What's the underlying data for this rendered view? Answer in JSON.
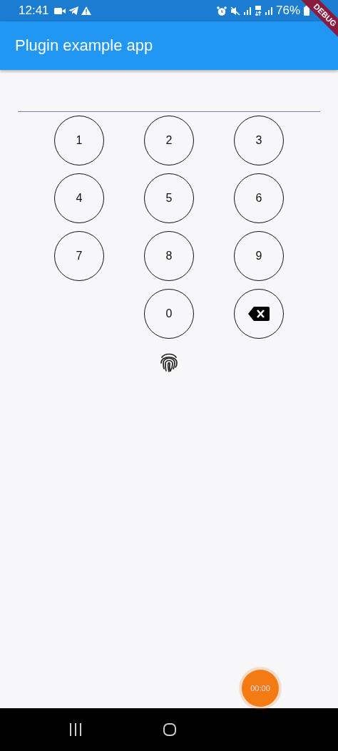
{
  "status_bar": {
    "time": "12:41",
    "battery": "76%"
  },
  "app_bar": {
    "title": "Plugin example app"
  },
  "debug_banner": {
    "label": "DEBUG"
  },
  "keypad": [
    {
      "kind": "digit",
      "label": "1"
    },
    {
      "kind": "digit",
      "label": "2"
    },
    {
      "kind": "digit",
      "label": "3"
    },
    {
      "kind": "digit",
      "label": "4"
    },
    {
      "kind": "digit",
      "label": "5"
    },
    {
      "kind": "digit",
      "label": "6"
    },
    {
      "kind": "digit",
      "label": "7"
    },
    {
      "kind": "digit",
      "label": "8"
    },
    {
      "kind": "digit",
      "label": "9"
    },
    {
      "kind": "blank"
    },
    {
      "kind": "digit",
      "label": "0"
    },
    {
      "kind": "backspace"
    }
  ],
  "recorder_bubble": {
    "time": "00:00"
  }
}
